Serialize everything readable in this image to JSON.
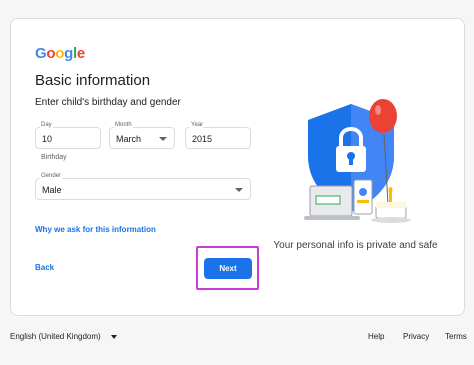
{
  "logo": {
    "letters": [
      "G",
      "o",
      "o",
      "g",
      "l",
      "e"
    ]
  },
  "colors": {
    "accent": "#1a73e8",
    "highlight": "#c83bd6",
    "shield": "#1a73e8",
    "balloon": "#ea4335"
  },
  "page": {
    "title": "Basic information",
    "subtitle": "Enter child's birthday and gender"
  },
  "birthday": {
    "day": {
      "label": "Day",
      "value": "10"
    },
    "month": {
      "label": "Month",
      "value": "March"
    },
    "year": {
      "label": "Year",
      "value": "2015"
    },
    "hint": "Birthday"
  },
  "gender": {
    "label": "Gender",
    "value": "Male"
  },
  "links": {
    "why": "Why we ask for this information",
    "back": "Back"
  },
  "buttons": {
    "next": "Next"
  },
  "illustration": {
    "icons": [
      "shield-lock-icon",
      "balloon-icon",
      "laptop-icon",
      "phone-icon",
      "cake-icon"
    ],
    "caption": "Your personal info is private and safe"
  },
  "footer": {
    "language": "English (United Kingdom)",
    "help": "Help",
    "privacy": "Privacy",
    "terms": "Terms"
  }
}
